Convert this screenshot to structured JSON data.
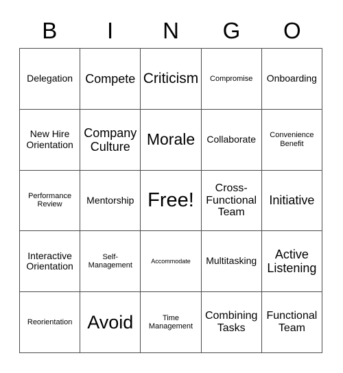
{
  "card": {
    "title": "BINGO",
    "header_letters": [
      "B",
      "I",
      "N",
      "G",
      "O"
    ],
    "background_color": "#ffffff",
    "border_color": "#4a4a4a",
    "text_color": "#000000",
    "grid_size": "5x5"
  },
  "cells": [
    {
      "text": "Delegation",
      "size": "m",
      "row": 1,
      "col": "B",
      "free": false
    },
    {
      "text": "Compete",
      "size": "xl",
      "row": 1,
      "col": "I",
      "free": false
    },
    {
      "text": "Criticism",
      "size": "2xl",
      "row": 1,
      "col": "N",
      "free": false
    },
    {
      "text": "Compromise",
      "size": "xs",
      "row": 1,
      "col": "G",
      "free": false
    },
    {
      "text": "Onboarding",
      "size": "m",
      "row": 1,
      "col": "O",
      "free": false
    },
    {
      "text": "New Hire Orientation",
      "size": "m",
      "row": 2,
      "col": "B",
      "free": false
    },
    {
      "text": "Company Culture",
      "size": "xl",
      "row": 2,
      "col": "I",
      "free": false
    },
    {
      "text": "Morale",
      "size": "3xl",
      "row": 2,
      "col": "N",
      "free": false
    },
    {
      "text": "Collaborate",
      "size": "m",
      "row": 2,
      "col": "G",
      "free": false
    },
    {
      "text": "Convenience Benefit",
      "size": "xs",
      "row": 2,
      "col": "O",
      "free": false
    },
    {
      "text": "Performance Review",
      "size": "xs",
      "row": 3,
      "col": "B",
      "free": false
    },
    {
      "text": "Mentorship",
      "size": "m",
      "row": 3,
      "col": "I",
      "free": false
    },
    {
      "text": "Free!",
      "size": "5xl",
      "row": 3,
      "col": "N",
      "free": true
    },
    {
      "text": "Cross-Functional Team",
      "size": "l",
      "row": 3,
      "col": "G",
      "free": false
    },
    {
      "text": "Initiative",
      "size": "xl",
      "row": 3,
      "col": "O",
      "free": false
    },
    {
      "text": "Interactive Orientation",
      "size": "m",
      "row": 4,
      "col": "B",
      "free": false
    },
    {
      "text": "Self-Management",
      "size": "xs",
      "row": 4,
      "col": "I",
      "free": false
    },
    {
      "text": "Accommodate",
      "size": "xxs",
      "row": 4,
      "col": "N",
      "free": false
    },
    {
      "text": "Multitasking",
      "size": "m",
      "row": 4,
      "col": "G",
      "free": false
    },
    {
      "text": "Active Listening",
      "size": "xl",
      "row": 4,
      "col": "O",
      "free": false
    },
    {
      "text": "Reorientation",
      "size": "xs",
      "row": 5,
      "col": "B",
      "free": false
    },
    {
      "text": "Avoid",
      "size": "4xl",
      "row": 5,
      "col": "I",
      "free": false
    },
    {
      "text": "Time Management",
      "size": "xs",
      "row": 5,
      "col": "N",
      "free": false
    },
    {
      "text": "Combining Tasks",
      "size": "l",
      "row": 5,
      "col": "G",
      "free": false
    },
    {
      "text": "Functional Team",
      "size": "l",
      "row": 5,
      "col": "O",
      "free": false
    }
  ]
}
